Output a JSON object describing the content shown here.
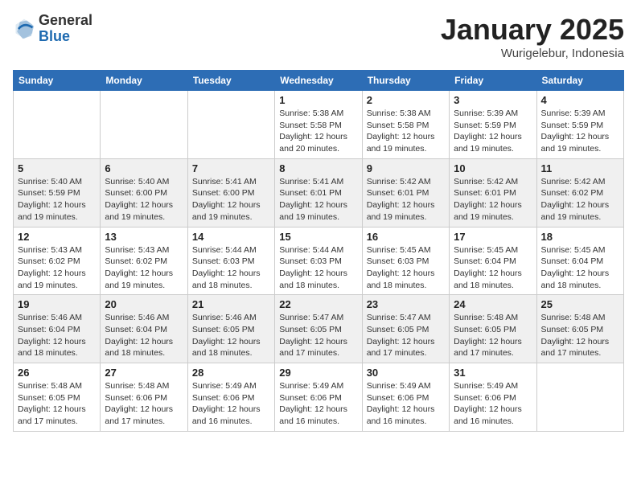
{
  "header": {
    "logo_general": "General",
    "logo_blue": "Blue",
    "month_title": "January 2025",
    "location": "Wurigelebur, Indonesia"
  },
  "days_of_week": [
    "Sunday",
    "Monday",
    "Tuesday",
    "Wednesday",
    "Thursday",
    "Friday",
    "Saturday"
  ],
  "weeks": [
    [
      {
        "day": "",
        "info": ""
      },
      {
        "day": "",
        "info": ""
      },
      {
        "day": "",
        "info": ""
      },
      {
        "day": "1",
        "info": "Sunrise: 5:38 AM\nSunset: 5:58 PM\nDaylight: 12 hours and 20 minutes."
      },
      {
        "day": "2",
        "info": "Sunrise: 5:38 AM\nSunset: 5:58 PM\nDaylight: 12 hours and 19 minutes."
      },
      {
        "day": "3",
        "info": "Sunrise: 5:39 AM\nSunset: 5:59 PM\nDaylight: 12 hours and 19 minutes."
      },
      {
        "day": "4",
        "info": "Sunrise: 5:39 AM\nSunset: 5:59 PM\nDaylight: 12 hours and 19 minutes."
      }
    ],
    [
      {
        "day": "5",
        "info": "Sunrise: 5:40 AM\nSunset: 5:59 PM\nDaylight: 12 hours and 19 minutes."
      },
      {
        "day": "6",
        "info": "Sunrise: 5:40 AM\nSunset: 6:00 PM\nDaylight: 12 hours and 19 minutes."
      },
      {
        "day": "7",
        "info": "Sunrise: 5:41 AM\nSunset: 6:00 PM\nDaylight: 12 hours and 19 minutes."
      },
      {
        "day": "8",
        "info": "Sunrise: 5:41 AM\nSunset: 6:01 PM\nDaylight: 12 hours and 19 minutes."
      },
      {
        "day": "9",
        "info": "Sunrise: 5:42 AM\nSunset: 6:01 PM\nDaylight: 12 hours and 19 minutes."
      },
      {
        "day": "10",
        "info": "Sunrise: 5:42 AM\nSunset: 6:01 PM\nDaylight: 12 hours and 19 minutes."
      },
      {
        "day": "11",
        "info": "Sunrise: 5:42 AM\nSunset: 6:02 PM\nDaylight: 12 hours and 19 minutes."
      }
    ],
    [
      {
        "day": "12",
        "info": "Sunrise: 5:43 AM\nSunset: 6:02 PM\nDaylight: 12 hours and 19 minutes."
      },
      {
        "day": "13",
        "info": "Sunrise: 5:43 AM\nSunset: 6:02 PM\nDaylight: 12 hours and 19 minutes."
      },
      {
        "day": "14",
        "info": "Sunrise: 5:44 AM\nSunset: 6:03 PM\nDaylight: 12 hours and 18 minutes."
      },
      {
        "day": "15",
        "info": "Sunrise: 5:44 AM\nSunset: 6:03 PM\nDaylight: 12 hours and 18 minutes."
      },
      {
        "day": "16",
        "info": "Sunrise: 5:45 AM\nSunset: 6:03 PM\nDaylight: 12 hours and 18 minutes."
      },
      {
        "day": "17",
        "info": "Sunrise: 5:45 AM\nSunset: 6:04 PM\nDaylight: 12 hours and 18 minutes."
      },
      {
        "day": "18",
        "info": "Sunrise: 5:45 AM\nSunset: 6:04 PM\nDaylight: 12 hours and 18 minutes."
      }
    ],
    [
      {
        "day": "19",
        "info": "Sunrise: 5:46 AM\nSunset: 6:04 PM\nDaylight: 12 hours and 18 minutes."
      },
      {
        "day": "20",
        "info": "Sunrise: 5:46 AM\nSunset: 6:04 PM\nDaylight: 12 hours and 18 minutes."
      },
      {
        "day": "21",
        "info": "Sunrise: 5:46 AM\nSunset: 6:05 PM\nDaylight: 12 hours and 18 minutes."
      },
      {
        "day": "22",
        "info": "Sunrise: 5:47 AM\nSunset: 6:05 PM\nDaylight: 12 hours and 17 minutes."
      },
      {
        "day": "23",
        "info": "Sunrise: 5:47 AM\nSunset: 6:05 PM\nDaylight: 12 hours and 17 minutes."
      },
      {
        "day": "24",
        "info": "Sunrise: 5:48 AM\nSunset: 6:05 PM\nDaylight: 12 hours and 17 minutes."
      },
      {
        "day": "25",
        "info": "Sunrise: 5:48 AM\nSunset: 6:05 PM\nDaylight: 12 hours and 17 minutes."
      }
    ],
    [
      {
        "day": "26",
        "info": "Sunrise: 5:48 AM\nSunset: 6:05 PM\nDaylight: 12 hours and 17 minutes."
      },
      {
        "day": "27",
        "info": "Sunrise: 5:48 AM\nSunset: 6:06 PM\nDaylight: 12 hours and 17 minutes."
      },
      {
        "day": "28",
        "info": "Sunrise: 5:49 AM\nSunset: 6:06 PM\nDaylight: 12 hours and 16 minutes."
      },
      {
        "day": "29",
        "info": "Sunrise: 5:49 AM\nSunset: 6:06 PM\nDaylight: 12 hours and 16 minutes."
      },
      {
        "day": "30",
        "info": "Sunrise: 5:49 AM\nSunset: 6:06 PM\nDaylight: 12 hours and 16 minutes."
      },
      {
        "day": "31",
        "info": "Sunrise: 5:49 AM\nSunset: 6:06 PM\nDaylight: 12 hours and 16 minutes."
      },
      {
        "day": "",
        "info": ""
      }
    ]
  ]
}
